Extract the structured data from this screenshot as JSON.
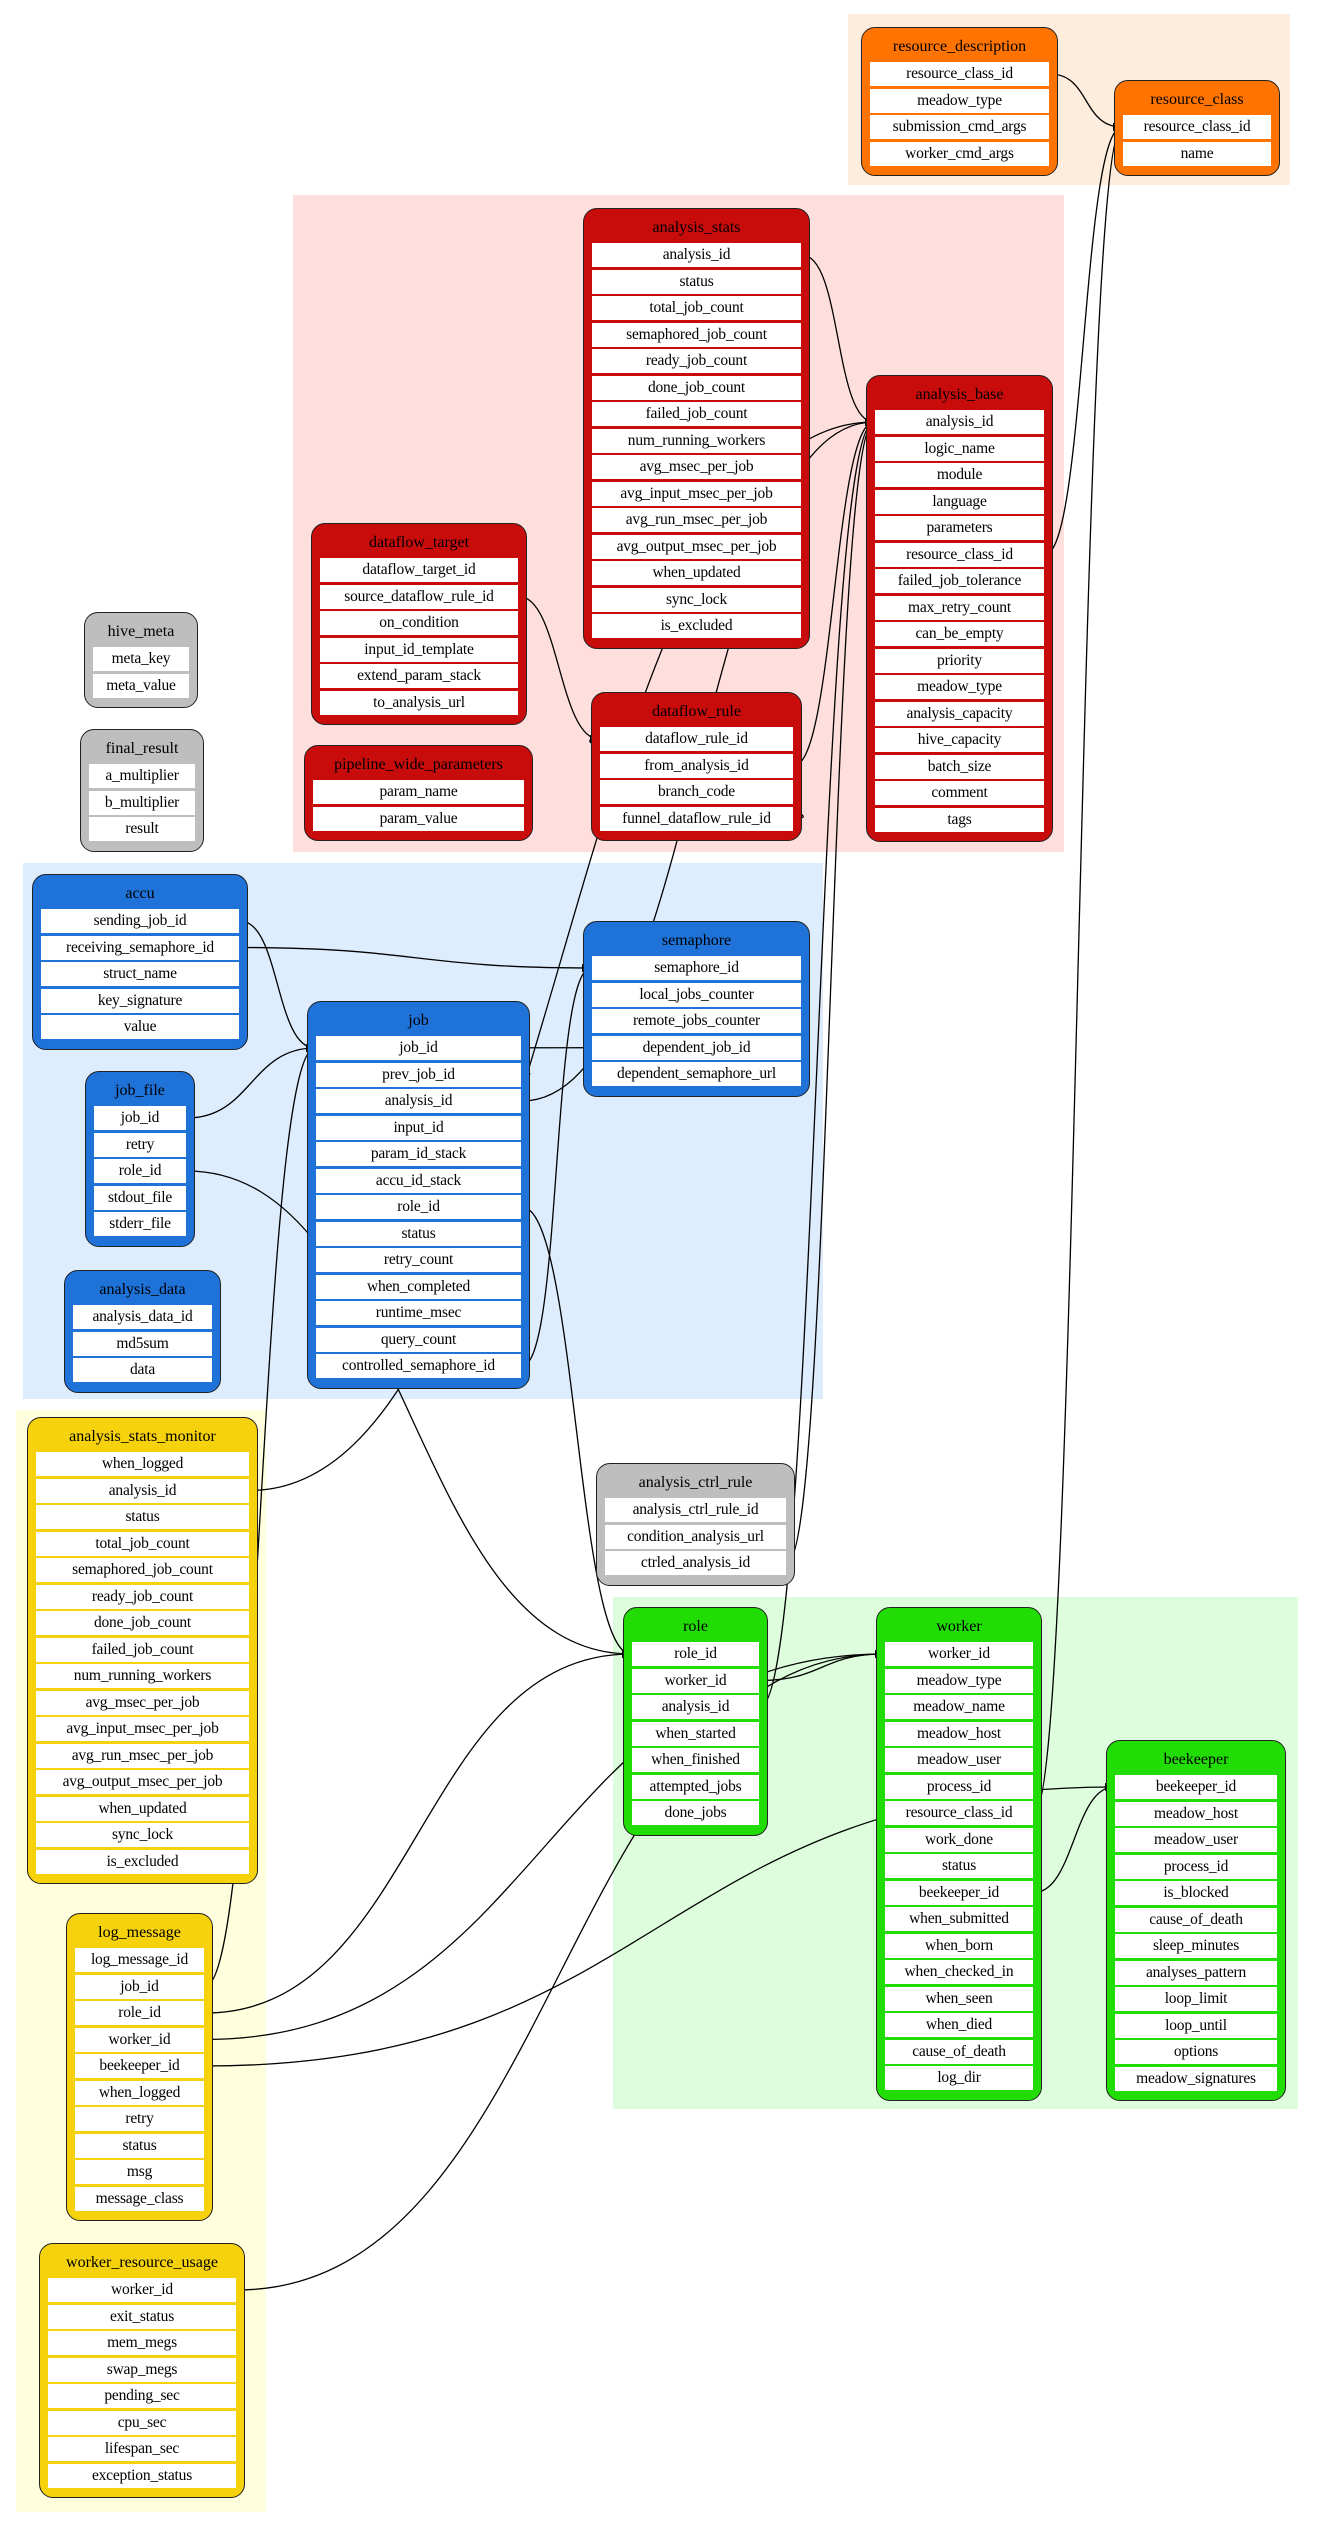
{
  "colors": {
    "orange": {
      "node": "#ff7400",
      "cluster": "#feeddc"
    },
    "red": {
      "node": "#c80c0c",
      "cluster": "#ffdede"
    },
    "blue": {
      "node": "#1f72d8",
      "cluster": "#ddedfd"
    },
    "yellow": {
      "node": "#f5d20b",
      "cluster": "#ffffde"
    },
    "green": {
      "node": "#22dc05",
      "cluster": "#ddfddc"
    },
    "gray": {
      "node": "#bebebe"
    }
  },
  "tables": [
    {
      "name": "resource_description",
      "color": "orange",
      "rows": [
        "resource_class_id",
        "meadow_type",
        "submission_cmd_args",
        "worker_cmd_args"
      ]
    },
    {
      "name": "resource_class",
      "color": "orange",
      "rows": [
        "resource_class_id",
        "name"
      ]
    },
    {
      "name": "analysis_stats",
      "color": "red",
      "rows": [
        "analysis_id",
        "status",
        "total_job_count",
        "semaphored_job_count",
        "ready_job_count",
        "done_job_count",
        "failed_job_count",
        "num_running_workers",
        "avg_msec_per_job",
        "avg_input_msec_per_job",
        "avg_run_msec_per_job",
        "avg_output_msec_per_job",
        "when_updated",
        "sync_lock",
        "is_excluded"
      ]
    },
    {
      "name": "analysis_base",
      "color": "red",
      "rows": [
        "analysis_id",
        "logic_name",
        "module",
        "language",
        "parameters",
        "resource_class_id",
        "failed_job_tolerance",
        "max_retry_count",
        "can_be_empty",
        "priority",
        "meadow_type",
        "analysis_capacity",
        "hive_capacity",
        "batch_size",
        "comment",
        "tags"
      ]
    },
    {
      "name": "dataflow_target",
      "color": "red",
      "rows": [
        "dataflow_target_id",
        "source_dataflow_rule_id",
        "on_condition",
        "input_id_template",
        "extend_param_stack",
        "to_analysis_url"
      ]
    },
    {
      "name": "pipeline_wide_parameters",
      "color": "red",
      "rows": [
        "param_name",
        "param_value"
      ]
    },
    {
      "name": "dataflow_rule",
      "color": "red",
      "rows": [
        "dataflow_rule_id",
        "from_analysis_id",
        "branch_code",
        "funnel_dataflow_rule_id"
      ]
    },
    {
      "name": "hive_meta",
      "color": "gray",
      "rows": [
        "meta_key",
        "meta_value"
      ]
    },
    {
      "name": "final_result",
      "color": "gray",
      "rows": [
        "a_multiplier",
        "b_multiplier",
        "result"
      ]
    },
    {
      "name": "accu",
      "color": "blue",
      "rows": [
        "sending_job_id",
        "receiving_semaphore_id",
        "struct_name",
        "key_signature",
        "value"
      ]
    },
    {
      "name": "semaphore",
      "color": "blue",
      "rows": [
        "semaphore_id",
        "local_jobs_counter",
        "remote_jobs_counter",
        "dependent_job_id",
        "dependent_semaphore_url"
      ]
    },
    {
      "name": "job",
      "color": "blue",
      "rows": [
        "job_id",
        "prev_job_id",
        "analysis_id",
        "input_id",
        "param_id_stack",
        "accu_id_stack",
        "role_id",
        "status",
        "retry_count",
        "when_completed",
        "runtime_msec",
        "query_count",
        "controlled_semaphore_id"
      ]
    },
    {
      "name": "job_file",
      "color": "blue",
      "rows": [
        "job_id",
        "retry",
        "role_id",
        "stdout_file",
        "stderr_file"
      ]
    },
    {
      "name": "analysis_data",
      "color": "blue",
      "rows": [
        "analysis_data_id",
        "md5sum",
        "data"
      ]
    },
    {
      "name": "analysis_stats_monitor",
      "color": "yellow",
      "rows": [
        "when_logged",
        "analysis_id",
        "status",
        "total_job_count",
        "semaphored_job_count",
        "ready_job_count",
        "done_job_count",
        "failed_job_count",
        "num_running_workers",
        "avg_msec_per_job",
        "avg_input_msec_per_job",
        "avg_run_msec_per_job",
        "avg_output_msec_per_job",
        "when_updated",
        "sync_lock",
        "is_excluded"
      ]
    },
    {
      "name": "log_message",
      "color": "yellow",
      "rows": [
        "log_message_id",
        "job_id",
        "role_id",
        "worker_id",
        "beekeeper_id",
        "when_logged",
        "retry",
        "status",
        "msg",
        "message_class"
      ]
    },
    {
      "name": "worker_resource_usage",
      "color": "yellow",
      "rows": [
        "worker_id",
        "exit_status",
        "mem_megs",
        "swap_megs",
        "pending_sec",
        "cpu_sec",
        "lifespan_sec",
        "exception_status"
      ]
    },
    {
      "name": "analysis_ctrl_rule",
      "color": "gray",
      "rows": [
        "analysis_ctrl_rule_id",
        "condition_analysis_url",
        "ctrled_analysis_id"
      ]
    },
    {
      "name": "role",
      "color": "green",
      "rows": [
        "role_id",
        "worker_id",
        "analysis_id",
        "when_started",
        "when_finished",
        "attempted_jobs",
        "done_jobs"
      ]
    },
    {
      "name": "worker",
      "color": "green",
      "rows": [
        "worker_id",
        "meadow_type",
        "meadow_name",
        "meadow_host",
        "meadow_user",
        "process_id",
        "resource_class_id",
        "work_done",
        "status",
        "beekeeper_id",
        "when_submitted",
        "when_born",
        "when_checked_in",
        "when_seen",
        "when_died",
        "cause_of_death",
        "log_dir"
      ]
    },
    {
      "name": "beekeeper",
      "color": "green",
      "rows": [
        "beekeeper_id",
        "meadow_host",
        "meadow_user",
        "process_id",
        "is_blocked",
        "cause_of_death",
        "sleep_minutes",
        "analyses_pattern",
        "loop_limit",
        "loop_until",
        "options",
        "meadow_signatures"
      ]
    }
  ],
  "relations": [
    [
      "resource_description.resource_class_id",
      "resource_class.resource_class_id"
    ],
    [
      "analysis_base.resource_class_id",
      "resource_class.resource_class_id"
    ],
    [
      "worker.resource_class_id",
      "resource_class.resource_class_id"
    ],
    [
      "analysis_stats.analysis_id",
      "analysis_base.analysis_id"
    ],
    [
      "dataflow_target.source_dataflow_rule_id",
      "dataflow_rule.dataflow_rule_id"
    ],
    [
      "dataflow_rule.from_analysis_id",
      "analysis_base.analysis_id"
    ],
    [
      "dataflow_rule.funnel_dataflow_rule_id",
      "dataflow_rule.dataflow_rule_id"
    ],
    [
      "job.analysis_id",
      "analysis_base.analysis_id"
    ],
    [
      "analysis_stats_monitor.analysis_id",
      "analysis_base.analysis_id"
    ],
    [
      "analysis_ctrl_rule.ctrled_analysis_id",
      "analysis_base.analysis_id"
    ],
    [
      "role.analysis_id",
      "analysis_base.analysis_id"
    ],
    [
      "accu.sending_job_id",
      "job.job_id"
    ],
    [
      "accu.receiving_semaphore_id",
      "semaphore.semaphore_id"
    ],
    [
      "job.prev_job_id",
      "job.job_id"
    ],
    [
      "job.controlled_semaphore_id",
      "semaphore.semaphore_id"
    ],
    [
      "semaphore.dependent_job_id",
      "job.job_id"
    ],
    [
      "job_file.job_id",
      "job.job_id"
    ],
    [
      "job_file.role_id",
      "role.role_id"
    ],
    [
      "job.role_id",
      "role.role_id"
    ],
    [
      "log_message.job_id",
      "job.job_id"
    ],
    [
      "log_message.role_id",
      "role.role_id"
    ],
    [
      "log_message.worker_id",
      "worker.worker_id"
    ],
    [
      "log_message.beekeeper_id",
      "beekeeper.beekeeper_id"
    ],
    [
      "worker_resource_usage.worker_id",
      "worker.worker_id"
    ],
    [
      "role.worker_id",
      "worker.worker_id"
    ],
    [
      "worker.beekeeper_id",
      "beekeeper.beekeeper_id"
    ]
  ]
}
